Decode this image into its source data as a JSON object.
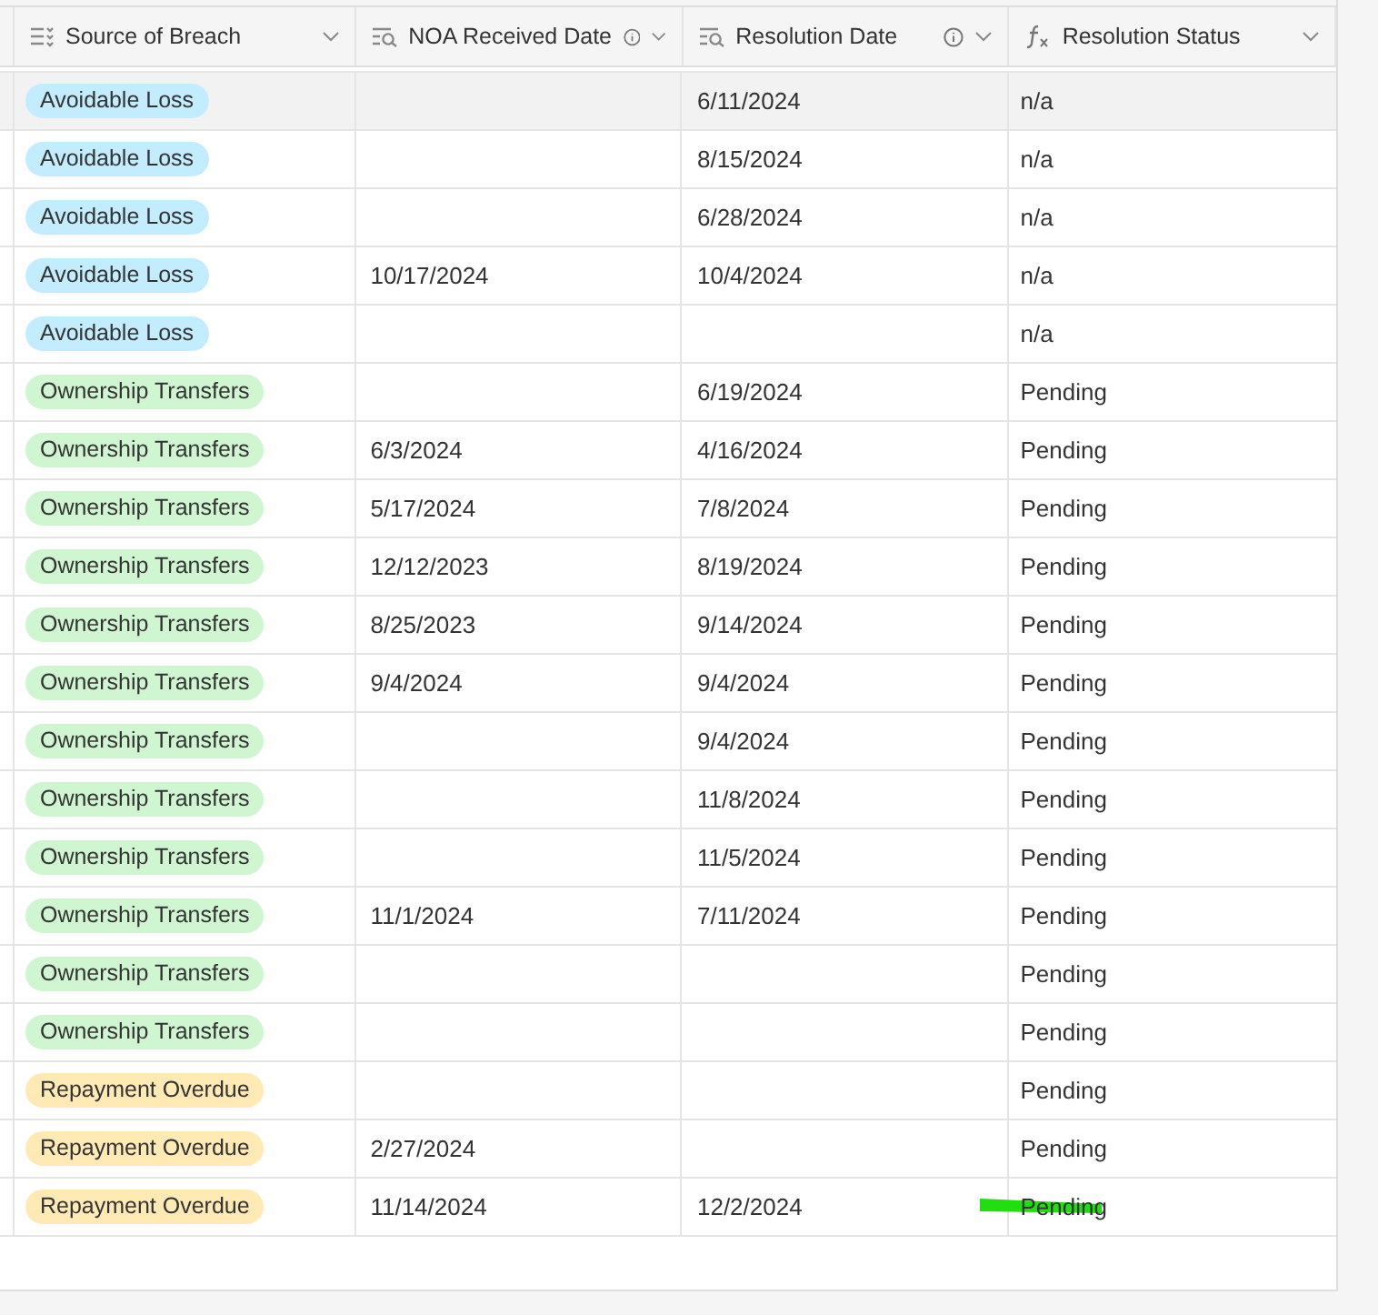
{
  "columns": [
    {
      "label": "Source of Breach",
      "kind": "select",
      "info": false
    },
    {
      "label": "NOA Received Date",
      "kind": "lookup",
      "info": true
    },
    {
      "label": "Resolution Date",
      "kind": "lookup",
      "info": true
    },
    {
      "label": "Resolution Status",
      "kind": "formula",
      "info": false
    }
  ],
  "rows": [
    {
      "source": {
        "label": "Avoidable Loss",
        "color": "#c4ecff"
      },
      "noa": "",
      "resolution": "6/11/2024",
      "status": "n/a",
      "hovered": true,
      "highlighted": false
    },
    {
      "source": {
        "label": "Avoidable Loss",
        "color": "#c4ecff"
      },
      "noa": "",
      "resolution": "8/15/2024",
      "status": "n/a",
      "hovered": false,
      "highlighted": false
    },
    {
      "source": {
        "label": "Avoidable Loss",
        "color": "#c4ecff"
      },
      "noa": "",
      "resolution": "6/28/2024",
      "status": "n/a",
      "hovered": false,
      "highlighted": false
    },
    {
      "source": {
        "label": "Avoidable Loss",
        "color": "#c4ecff"
      },
      "noa": "10/17/2024",
      "resolution": "10/4/2024",
      "status": "n/a",
      "hovered": false,
      "highlighted": false
    },
    {
      "source": {
        "label": "Avoidable Loss",
        "color": "#c4ecff"
      },
      "noa": "",
      "resolution": "",
      "status": "n/a",
      "hovered": false,
      "highlighted": false
    },
    {
      "source": {
        "label": "Ownership Transfers",
        "color": "#cff5d1"
      },
      "noa": "",
      "resolution": "6/19/2024",
      "status": "Pending",
      "hovered": false,
      "highlighted": false
    },
    {
      "source": {
        "label": "Ownership Transfers",
        "color": "#cff5d1"
      },
      "noa": "6/3/2024",
      "resolution": "4/16/2024",
      "status": "Pending",
      "hovered": false,
      "highlighted": false
    },
    {
      "source": {
        "label": "Ownership Transfers",
        "color": "#cff5d1"
      },
      "noa": "5/17/2024",
      "resolution": "7/8/2024",
      "status": "Pending",
      "hovered": false,
      "highlighted": false
    },
    {
      "source": {
        "label": "Ownership Transfers",
        "color": "#cff5d1"
      },
      "noa": "12/12/2023",
      "resolution": "8/19/2024",
      "status": "Pending",
      "hovered": false,
      "highlighted": false
    },
    {
      "source": {
        "label": "Ownership Transfers",
        "color": "#cff5d1"
      },
      "noa": "8/25/2023",
      "resolution": "9/14/2024",
      "status": "Pending",
      "hovered": false,
      "highlighted": false
    },
    {
      "source": {
        "label": "Ownership Transfers",
        "color": "#cff5d1"
      },
      "noa": "9/4/2024",
      "resolution": "9/4/2024",
      "status": "Pending",
      "hovered": false,
      "highlighted": false
    },
    {
      "source": {
        "label": "Ownership Transfers",
        "color": "#cff5d1"
      },
      "noa": "",
      "resolution": "9/4/2024",
      "status": "Pending",
      "hovered": false,
      "highlighted": false
    },
    {
      "source": {
        "label": "Ownership Transfers",
        "color": "#cff5d1"
      },
      "noa": "",
      "resolution": "11/8/2024",
      "status": "Pending",
      "hovered": false,
      "highlighted": false
    },
    {
      "source": {
        "label": "Ownership Transfers",
        "color": "#cff5d1"
      },
      "noa": "",
      "resolution": "11/5/2024",
      "status": "Pending",
      "hovered": false,
      "highlighted": false
    },
    {
      "source": {
        "label": "Ownership Transfers",
        "color": "#cff5d1"
      },
      "noa": "11/1/2024",
      "resolution": "7/11/2024",
      "status": "Pending",
      "hovered": false,
      "highlighted": false
    },
    {
      "source": {
        "label": "Ownership Transfers",
        "color": "#cff5d1"
      },
      "noa": "",
      "resolution": "",
      "status": "Pending",
      "hovered": false,
      "highlighted": false
    },
    {
      "source": {
        "label": "Ownership Transfers",
        "color": "#cff5d1"
      },
      "noa": "",
      "resolution": "",
      "status": "Pending",
      "hovered": false,
      "highlighted": false
    },
    {
      "source": {
        "label": "Repayment Overdue",
        "color": "#ffeab6"
      },
      "noa": "",
      "resolution": "",
      "status": "Pending",
      "hovered": false,
      "highlighted": false
    },
    {
      "source": {
        "label": "Repayment Overdue",
        "color": "#ffeab6"
      },
      "noa": "2/27/2024",
      "resolution": "",
      "status": "Pending",
      "hovered": false,
      "highlighted": false
    },
    {
      "source": {
        "label": "Repayment Overdue",
        "color": "#ffeab6"
      },
      "noa": "11/14/2024",
      "resolution": "12/2/2024",
      "status": "Pending",
      "hovered": false,
      "highlighted": true
    }
  ]
}
